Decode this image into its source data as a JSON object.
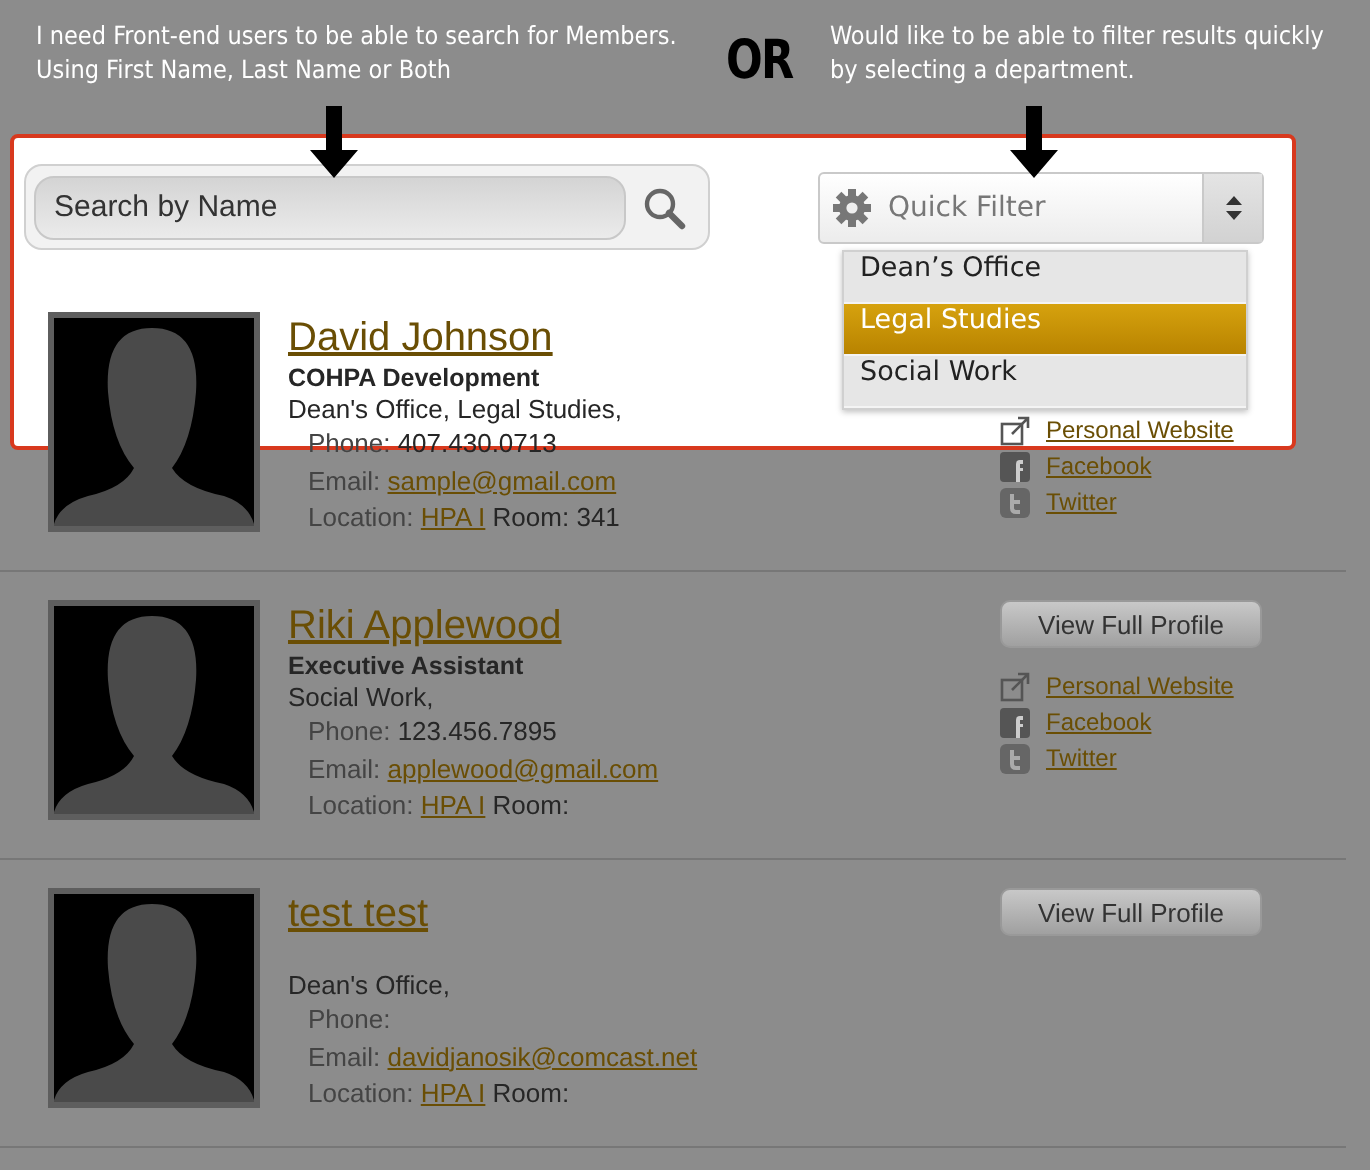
{
  "annotations": [
    {
      "lines": [
        "I need Front-end users to be able to search for Members.",
        "Using First Name, Last Name or Both"
      ]
    },
    {
      "lines": [
        "Would like to be able to filter results quickly",
        "by selecting a department."
      ]
    }
  ],
  "or_label": "OR",
  "search": {
    "placeholder": "Search by Name"
  },
  "filter": {
    "label": "Quick Filter",
    "expanded": true,
    "options": [
      {
        "label": "Dean’s Office",
        "selected": false
      },
      {
        "label": "Legal Studies",
        "selected": true
      },
      {
        "label": "Social Work",
        "selected": false
      }
    ]
  },
  "members": [
    {
      "name": "David Johnson",
      "title": "COHPA Development",
      "departments": "Dean's Office, Legal Studies,",
      "phone_label": "Phone:",
      "phone": "407.430.0713",
      "email_label": "Email:",
      "email": "sample@gmail.com",
      "location_label": "Location:",
      "location": "HPA I",
      "room_label": "Room:",
      "room": "341",
      "links": [
        {
          "kind": "website",
          "label": "Personal Website"
        },
        {
          "kind": "facebook",
          "label": "Facebook"
        },
        {
          "kind": "twitter",
          "label": "Twitter"
        }
      ]
    },
    {
      "name": "Riki Applewood",
      "title": "Executive Assistant",
      "departments": "Social Work,",
      "phone_label": "Phone:",
      "phone": "123.456.7895",
      "email_label": "Email:",
      "email": "applewood@gmail.com",
      "location_label": "Location:",
      "location": "HPA I",
      "room_label": "Room:",
      "profile_button": "View Full Profile",
      "links": [
        {
          "kind": "website",
          "label": "Personal Website"
        },
        {
          "kind": "facebook",
          "label": "Facebook"
        },
        {
          "kind": "twitter",
          "label": "Twitter"
        }
      ]
    },
    {
      "name": "test test",
      "departments": "Dean's Office,",
      "phone_label": "Phone:",
      "email_label": "Email:",
      "email": "davidjanosik@comcast.net",
      "location_label": "Location:",
      "location": "HPA I",
      "room_label": "Room:",
      "profile_button": "View Full Profile"
    }
  ]
}
